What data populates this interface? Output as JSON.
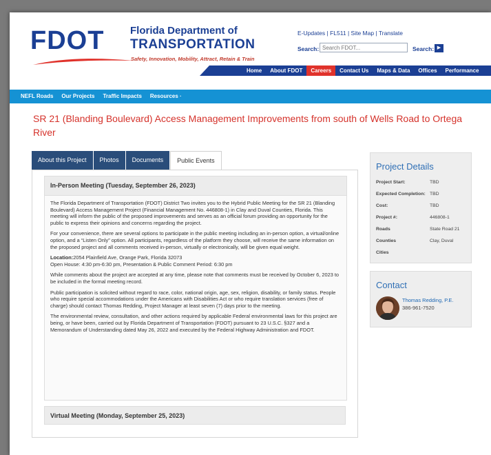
{
  "header": {
    "logo_text": "FDOT",
    "logo_line1": "Florida Department of",
    "logo_line2": "TRANSPORTATION",
    "tagline": "Safety, Innovation, Mobility, Attract, Retain & Train",
    "util_links": [
      "E-Updates",
      "FL511",
      "Site Map",
      "Translate"
    ],
    "search_label": "Search:",
    "search_placeholder": "Search FDOT...",
    "search_label2": "Search:"
  },
  "mainnav": [
    {
      "label": "Home",
      "active": false
    },
    {
      "label": "About FDOT",
      "active": false
    },
    {
      "label": "Careers",
      "active": true
    },
    {
      "label": "Contact Us",
      "active": false
    },
    {
      "label": "Maps & Data",
      "active": false
    },
    {
      "label": "Offices",
      "active": false
    },
    {
      "label": "Performance",
      "active": false
    }
  ],
  "subnav": [
    "NEFL Roads",
    "Our Projects",
    "Traffic Impacts",
    "Resources ·"
  ],
  "page_title": "SR 21 (Blanding Boulevard) Access Management Improvements from south of Wells Road to Ortega River",
  "tabs": [
    {
      "label": "About this Project",
      "active": false
    },
    {
      "label": "Photos",
      "active": false
    },
    {
      "label": "Documents",
      "active": false
    },
    {
      "label": "Public Events",
      "active": true
    }
  ],
  "meeting": {
    "heading": "In-Person Meeting (Tuesday, September 26, 2023)",
    "p1": "The Florida Department of Transportation (FDOT) District Two invites you to the Hybrid Public Meeting for the SR 21 (Blanding Boulevard) Access Management Project (Financial Management No. 446808-1) in Clay and Duval Counties, Florida. This meeting will inform the public of the proposed improvements and serves as an official forum providing an opportunity for the public to express their opinions and concerns regarding the project.",
    "p2": "For your convenience, there are several options to participate in the public meeting including an in-person option, a virtual/online option, and a “Listen Only” option. All participants, regardless of the platform they choose, will receive the same information on the proposed project and all comments received in-person, virtually or electronically, will be given equal weight.",
    "location_label": "Location:",
    "location": "2054 Plainfield Ave, Orange Park, Florida 32073",
    "open_house": "Open House: 4:30 pm-6:30 pm, Presentation & Public Comment Period: 6:30 pm",
    "p3": "While comments about the project are accepted at any time, please note that comments must be received by October 6, 2023 to be included in the formal meeting record.",
    "p4": "Public participation is solicited without regard to race, color, national origin, age, sex, religion, disability, or family status. People who require special accommodations under the Americans with Disabilities Act or who require translation services (free of charge) should contact Thomas Redding, Project Manager at least seven (7) days prior to the meeting.",
    "p5": "The environmental review, consultation, and other actions required by applicable Federal environmental laws for this project are being, or have been, carried out by Florida Department of Transportation (FDOT) pursuant to 23 U.S.C. §327 and a Memorandum of Understanding dated May 26, 2022 and executed by the Federal Highway Administration and FDOT."
  },
  "virtual_heading": "Virtual Meeting (Monday, September 25, 2023)",
  "details": {
    "title": "Project Details",
    "rows": [
      {
        "k": "Project Start:",
        "v": "TBD"
      },
      {
        "k": "Expected Completion:",
        "v": "TBD"
      },
      {
        "k": "Cost:",
        "v": "TBD"
      },
      {
        "k": "Project #:",
        "v": "446808-1"
      },
      {
        "k": "Roads",
        "v": "State Road 21"
      },
      {
        "k": "Counties",
        "v": "Clay, Duval"
      },
      {
        "k": "Cities",
        "v": ""
      }
    ]
  },
  "contact": {
    "title": "Contact",
    "name": "Thomas Redding, P.E.",
    "phone": "386-961-7520"
  },
  "colors": {
    "brand_blue": "#1b3f94",
    "sub_blue": "#1592d4",
    "red": "#d5322b"
  }
}
